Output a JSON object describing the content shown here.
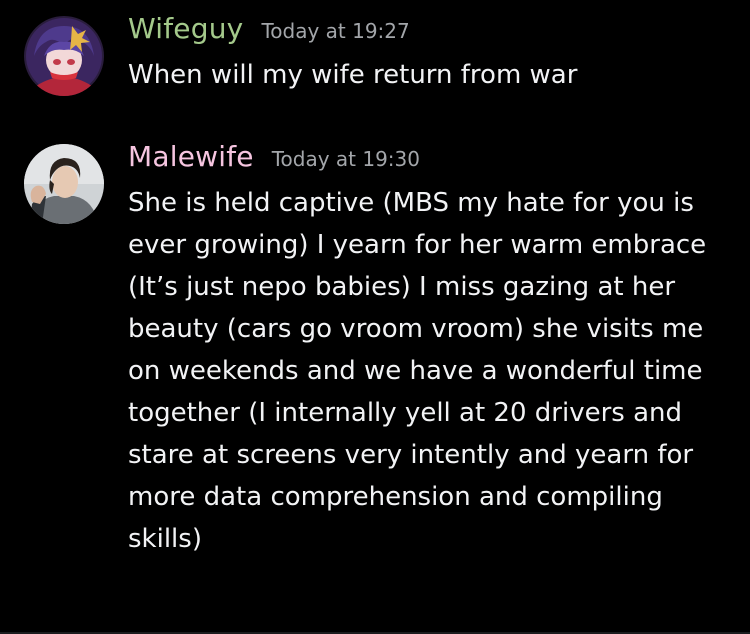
{
  "colors": {
    "background": "#000000",
    "timestamp": "#a3a6aa",
    "text": "#f2f3f5"
  },
  "messages": [
    {
      "username": "Wifeguy",
      "username_color": "#a4c98b",
      "timestamp": "Today at 19:27",
      "content": "When will my wife return from war",
      "avatar_icon": "anime-character-avatar-icon"
    },
    {
      "username": "Malewife",
      "username_color": "#f6c5e0",
      "timestamp": "Today at 19:30",
      "content": "She is held captive (MBS my hate for you is ever growing) I yearn for her warm embrace (It’s just nepo babies) I miss gazing at her beauty (cars go vroom vroom) she visits me on weekends and we have a wonderful time together (I internally yell at 20 drivers and stare at screens very intently and yearn for more data comprehension and compiling skills)",
      "avatar_icon": "person-photo-avatar-icon"
    }
  ]
}
